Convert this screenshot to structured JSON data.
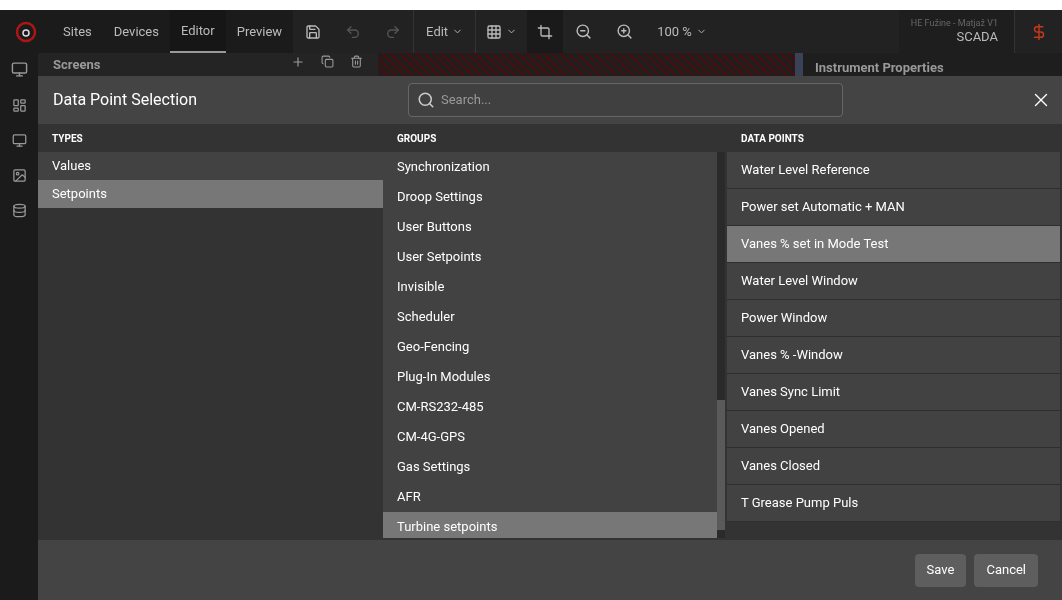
{
  "top_bar": {
    "nav_tabs": [
      {
        "label": "Sites",
        "selected": false
      },
      {
        "label": "Devices",
        "selected": false
      },
      {
        "label": "Editor",
        "selected": true
      },
      {
        "label": "Preview",
        "selected": false
      }
    ],
    "edit_menu": "Edit",
    "zoom": "100 %",
    "project": "HE Fužine - Matjaž V1",
    "mode": "SCADA"
  },
  "background": {
    "screens_title": "Screens",
    "properties_title": "Instrument Properties"
  },
  "dialog": {
    "title": "Data Point Selection",
    "search": {
      "placeholder": "Search..."
    },
    "types": {
      "heading": "TYPES",
      "items": [
        {
          "label": "Values",
          "selected": false
        },
        {
          "label": "Setpoints",
          "selected": true
        }
      ]
    },
    "groups": {
      "heading": "GROUPS",
      "items": [
        {
          "label": "Synchronization",
          "selected": false
        },
        {
          "label": "Droop Settings",
          "selected": false
        },
        {
          "label": "User Buttons",
          "selected": false
        },
        {
          "label": "User Setpoints",
          "selected": false
        },
        {
          "label": "Invisible",
          "selected": false
        },
        {
          "label": "Scheduler",
          "selected": false
        },
        {
          "label": "Geo-Fencing",
          "selected": false
        },
        {
          "label": "Plug-In Modules",
          "selected": false
        },
        {
          "label": "CM-RS232-485",
          "selected": false
        },
        {
          "label": "CM-4G-GPS",
          "selected": false
        },
        {
          "label": "Gas Settings",
          "selected": false
        },
        {
          "label": "AFR",
          "selected": false
        },
        {
          "label": "Turbine setpoints",
          "selected": true
        }
      ]
    },
    "data_points": {
      "heading": "DATA POINTS",
      "items": [
        {
          "label": "Water Level Reference",
          "selected": false
        },
        {
          "label": "Power set Automatic + MAN",
          "selected": false
        },
        {
          "label": "Vanes % set in Mode Test",
          "selected": true
        },
        {
          "label": "Water Level Window",
          "selected": false
        },
        {
          "label": "Power Window",
          "selected": false
        },
        {
          "label": "Vanes % -Window",
          "selected": false
        },
        {
          "label": "Vanes Sync Limit",
          "selected": false
        },
        {
          "label": "Vanes Opened",
          "selected": false
        },
        {
          "label": "Vanes Closed",
          "selected": false
        },
        {
          "label": "T Grease Pump Puls",
          "selected": false
        }
      ]
    },
    "buttons": [
      "Save",
      "Cancel"
    ]
  }
}
